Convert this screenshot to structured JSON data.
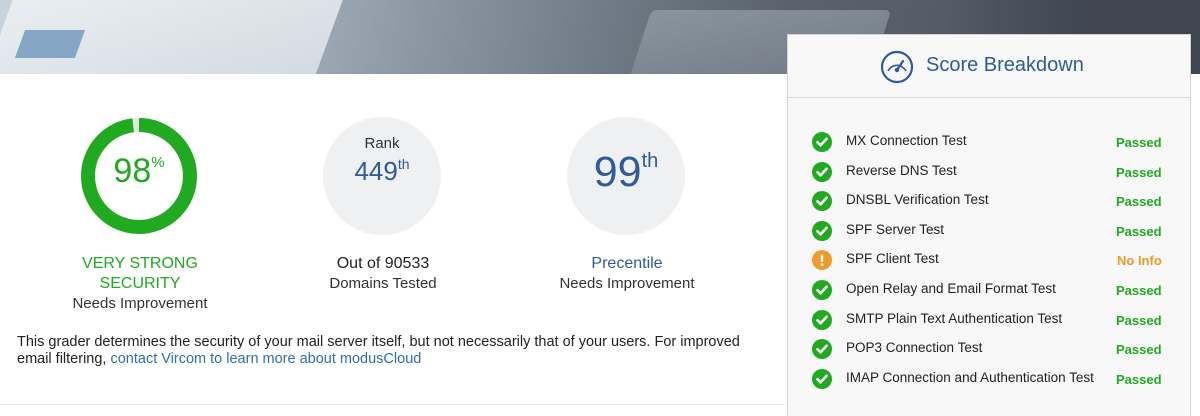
{
  "security": {
    "score": "98",
    "score_unit": "%",
    "score_fraction": 0.98,
    "rating_line1": "VERY STRONG",
    "rating_line2": "SECURITY",
    "rating_sub": "Needs Improvement",
    "color": "#1faa1f"
  },
  "rank": {
    "label": "Rank",
    "value": "449",
    "suffix": "th",
    "line1": "Out of 90533",
    "line2": "Domains Tested"
  },
  "percentile": {
    "value": "99",
    "suffix": "th",
    "line1": "Precentile",
    "line2": "Needs Improvement"
  },
  "blurb": {
    "text": "This grader determines the security of your mail server itself, but not necessarily that of your users. For improved email filtering, ",
    "link": "contact Vircom to learn more about modusCloud"
  },
  "panel": {
    "title": "Score Breakdown",
    "icon": "gauge-icon",
    "tests": [
      {
        "name": "MX Connection Test",
        "status": "Passed",
        "icon": "check-icon"
      },
      {
        "name": "Reverse DNS Test",
        "status": "Passed",
        "icon": "check-icon"
      },
      {
        "name": "DNSBL Verification Test",
        "status": "Passed",
        "icon": "check-icon"
      },
      {
        "name": "SPF Server Test",
        "status": "Passed",
        "icon": "check-icon"
      },
      {
        "name": "SPF Client Test",
        "status": "No Info",
        "icon": "warning-icon"
      },
      {
        "name": "Open Relay and Email Format Test",
        "status": "Passed",
        "icon": "check-icon"
      },
      {
        "name": "SMTP Plain Text Authentication Test",
        "status": "Passed",
        "icon": "check-icon"
      },
      {
        "name": "POP3 Connection Test",
        "status": "Passed",
        "icon": "check-icon"
      },
      {
        "name": "IMAP Connection and Authentication Test",
        "status": "Passed",
        "icon": "check-icon"
      }
    ]
  },
  "colors": {
    "pass": "#1faa1f",
    "warn": "#f09a2a",
    "accent": "#2e5b9c"
  }
}
